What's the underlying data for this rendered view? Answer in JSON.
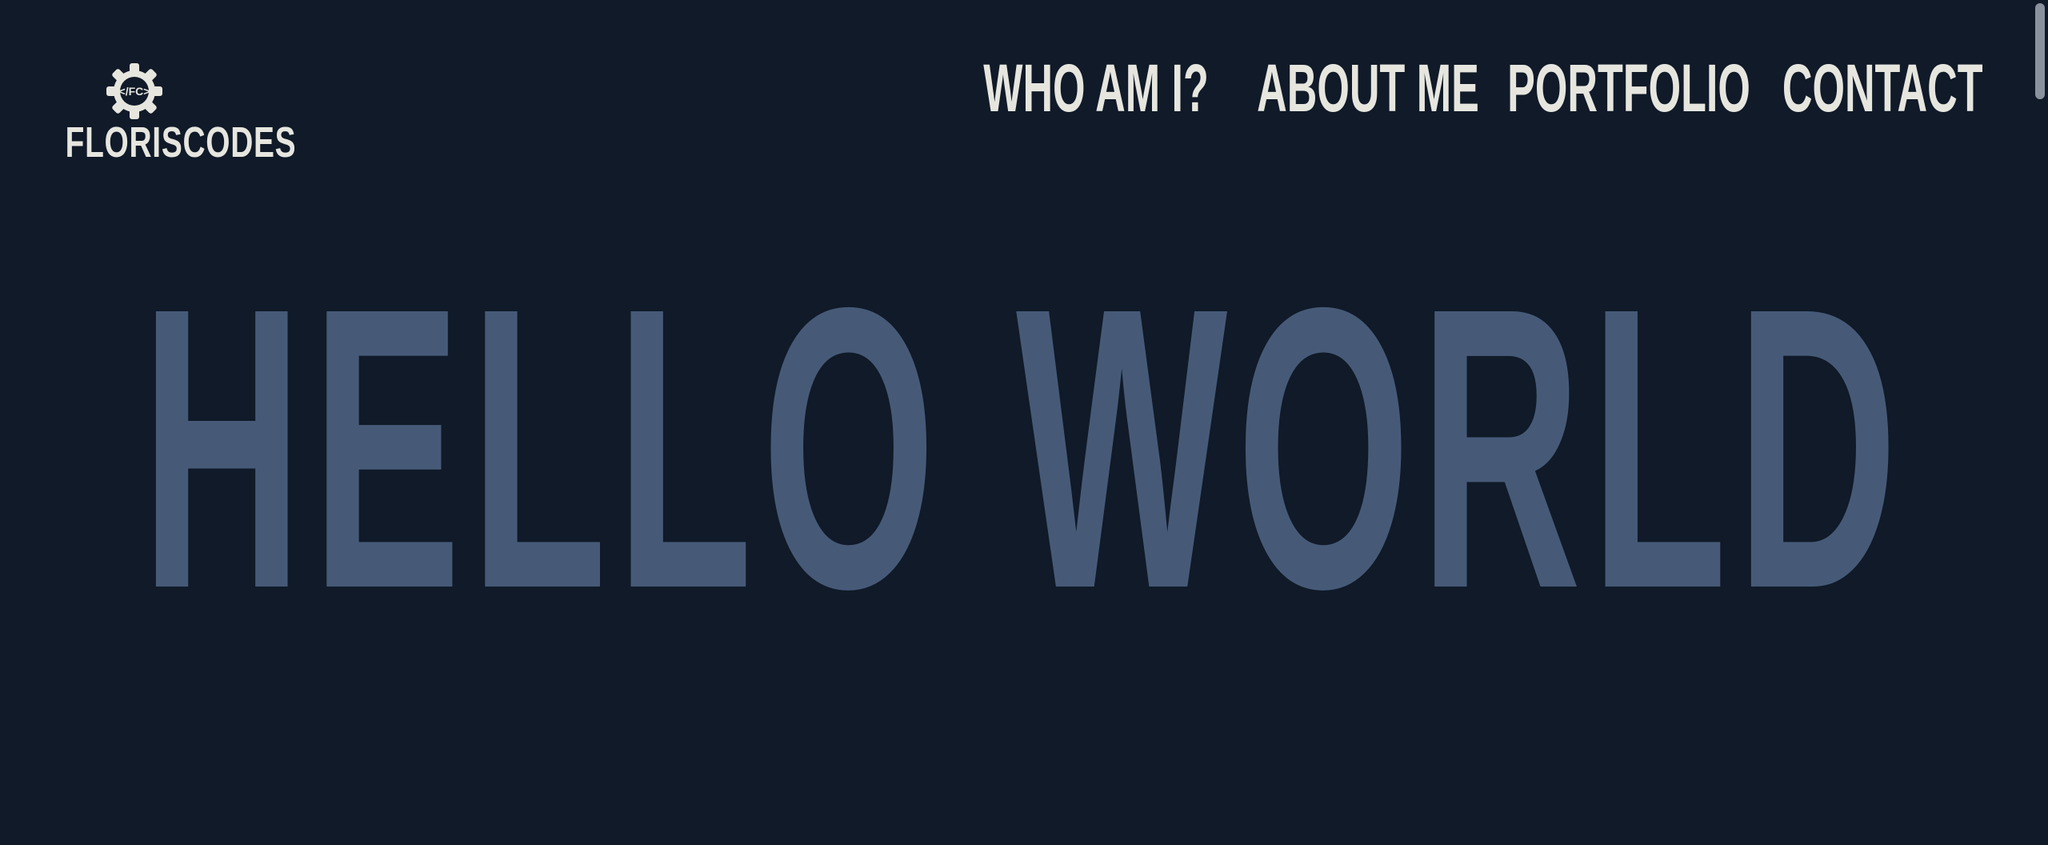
{
  "logo": {
    "gear_text": "</FC>",
    "word": "FLORISCODES",
    "icon": "gear-code-icon"
  },
  "nav": {
    "items": [
      {
        "label": "WHO AM I?"
      },
      {
        "label": "ABOUT ME"
      },
      {
        "label": "PORTFOLIO"
      },
      {
        "label": "CONTACT"
      }
    ]
  },
  "hero": {
    "title": "HELLO WORLD"
  },
  "colors": {
    "background": "#101a28",
    "nav_text": "#e6e6df",
    "hero_text": "#465a78",
    "scrollbar": "#8a929e"
  }
}
